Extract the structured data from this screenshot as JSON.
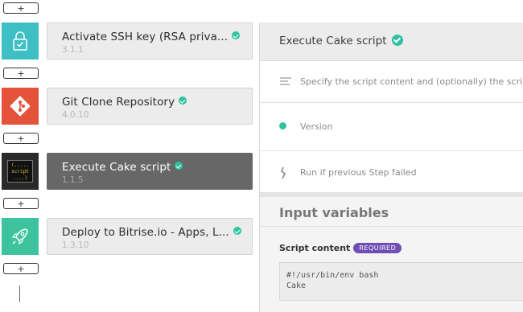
{
  "workflow": {
    "add_label": "+",
    "steps": [
      {
        "title": "Activate SSH key (RSA priva...",
        "version": "3.1.1",
        "verified": true,
        "icon": "lock-check-icon",
        "color": "#3dbfc4"
      },
      {
        "title": "Git Clone Repository",
        "version": "4.0.10",
        "verified": true,
        "icon": "git-icon",
        "color": "#e4523a"
      },
      {
        "title": "Execute Cake script",
        "version": "1.1.5",
        "verified": true,
        "icon": "cake-script-icon",
        "color": "#2a2a2a",
        "icon_lines": [
          "(.....",
          "script",
          "....)"
        ]
      },
      {
        "title": "Deploy to Bitrise.io - Apps, L...",
        "version": "1.3.10",
        "verified": true,
        "icon": "rocket-icon",
        "color": "#3dc49e"
      }
    ]
  },
  "panel": {
    "title": "Execute Cake script",
    "description": "Specify the script content and (optionally) the script",
    "version_label": "Version",
    "run_if_failed_label": "Run if previous Step failed",
    "section_title": "Input variables",
    "script_content_label": "Script content",
    "required_badge": "REQUIRED",
    "script_lines": [
      "#!/usr/bin/env bash",
      "Cake"
    ]
  }
}
